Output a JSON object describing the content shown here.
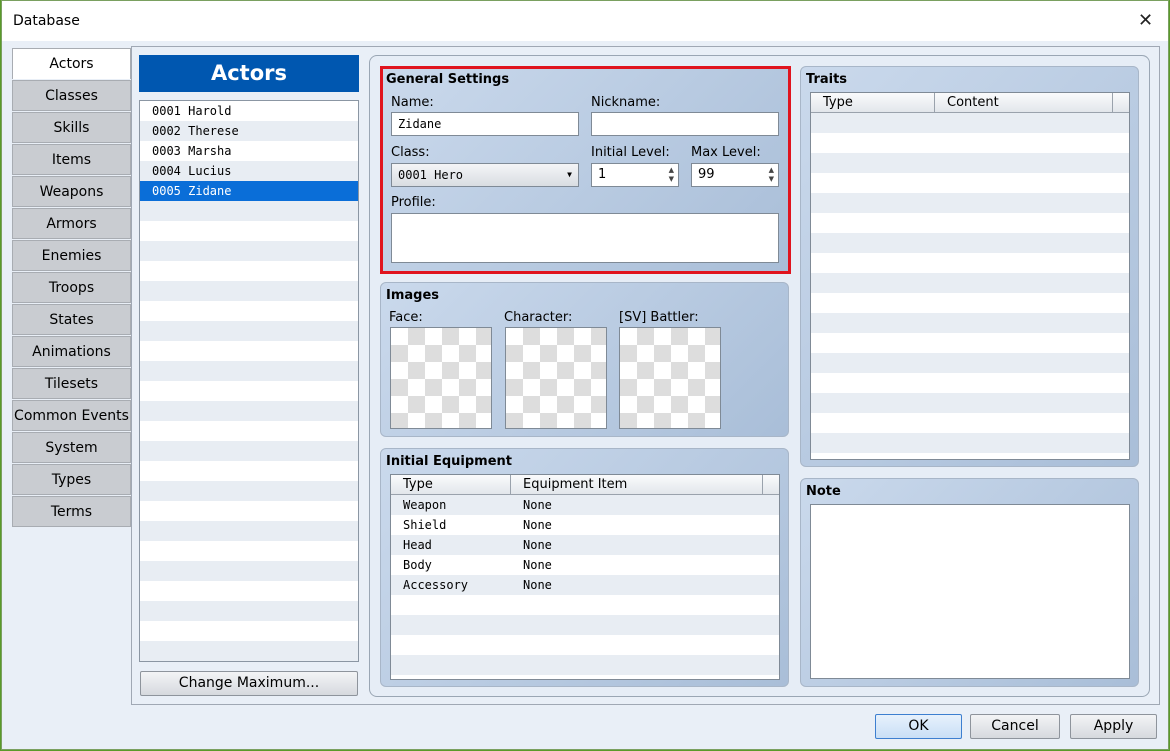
{
  "window": {
    "title": "Database",
    "close": "✕"
  },
  "tabs": [
    "Actors",
    "Classes",
    "Skills",
    "Items",
    "Weapons",
    "Armors",
    "Enemies",
    "Troops",
    "States",
    "Animations",
    "Tilesets",
    "Common Events",
    "System",
    "Types",
    "Terms"
  ],
  "list": {
    "header": "Actors",
    "items": [
      "0001 Harold",
      "0002 Therese",
      "0003 Marsha",
      "0004 Lucius",
      "0005 Zidane"
    ],
    "selected": 4,
    "change_max": "Change Maximum..."
  },
  "general": {
    "title": "General Settings",
    "name_label": "Name:",
    "name": "Zidane",
    "nickname_label": "Nickname:",
    "nickname": "",
    "class_label": "Class:",
    "class": "0001 Hero",
    "init_level_label": "Initial Level:",
    "init_level": "1",
    "max_level_label": "Max Level:",
    "max_level": "99",
    "profile_label": "Profile:"
  },
  "images": {
    "title": "Images",
    "face": "Face:",
    "character": "Character:",
    "battler": "[SV] Battler:"
  },
  "equipment": {
    "title": "Initial Equipment",
    "col_type": "Type",
    "col_item": "Equipment Item",
    "rows": [
      [
        "Weapon",
        "None"
      ],
      [
        "Shield",
        "None"
      ],
      [
        "Head",
        "None"
      ],
      [
        "Body",
        "None"
      ],
      [
        "Accessory",
        "None"
      ]
    ]
  },
  "traits": {
    "title": "Traits",
    "col_type": "Type",
    "col_content": "Content"
  },
  "note": {
    "title": "Note"
  },
  "buttons": {
    "ok": "OK",
    "cancel": "Cancel",
    "apply": "Apply"
  },
  "colors": {
    "highlight": "#e0141e",
    "header": "#0057b0",
    "selection": "#0a6ed8"
  }
}
